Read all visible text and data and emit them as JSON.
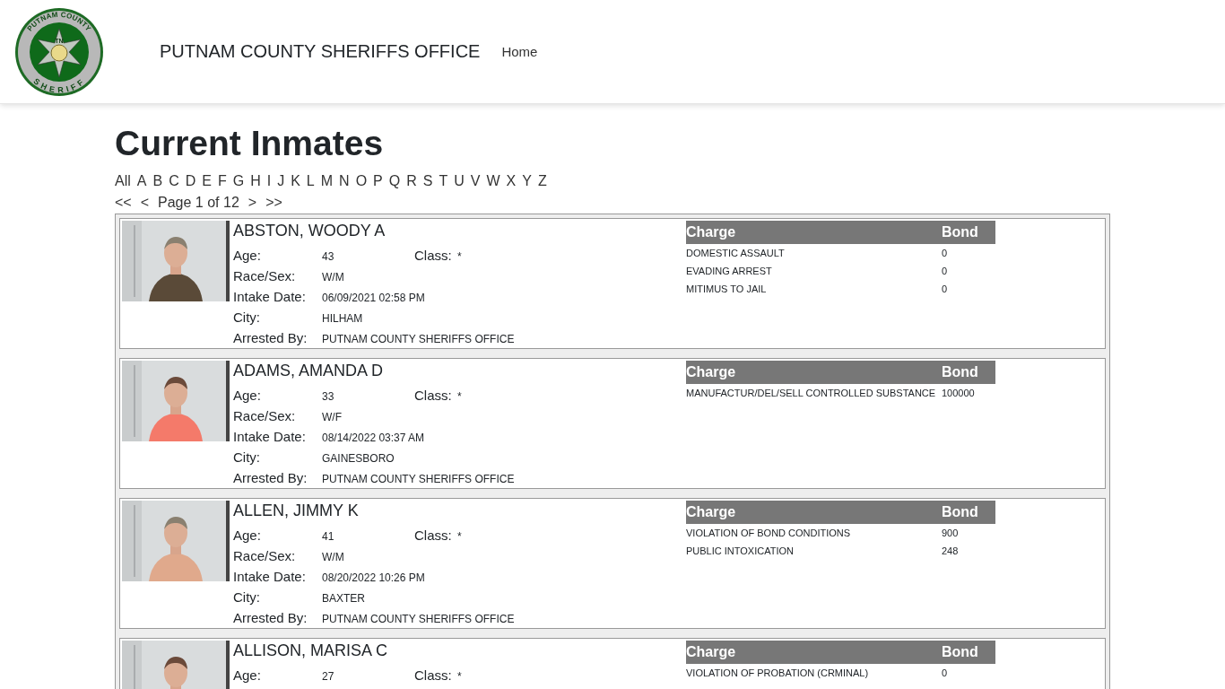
{
  "header": {
    "logo_top": "PUTNAM COUNTY",
    "logo_bottom": "SHERIFF",
    "logo_state": "TN",
    "brand": "PUTNAM COUNTY SHERIFFS OFFICE",
    "nav": [
      "Home"
    ]
  },
  "title": "Current Inmates",
  "letters": [
    "All",
    "A",
    "B",
    "C",
    "D",
    "E",
    "F",
    "G",
    "H",
    "I",
    "J",
    "K",
    "L",
    "M",
    "N",
    "O",
    "P",
    "Q",
    "R",
    "S",
    "T",
    "U",
    "V",
    "W",
    "X",
    "Y",
    "Z"
  ],
  "pager": {
    "first": "<<",
    "prev": "<",
    "label": "Page 1 of 12",
    "next": ">",
    "last": ">>"
  },
  "inmates": [
    {
      "name": "ABSTON, WOODY A",
      "fields": [
        {
          "label": "Age:",
          "value": "43"
        },
        {
          "label": "Race/Sex:",
          "value": "W/M"
        },
        {
          "label": "Intake Date:",
          "value": "06/09/2021 02:58 PM"
        },
        {
          "label": "City:",
          "value": "HILHAM"
        },
        {
          "label": "Arrested By:",
          "value": "PUTNAM COUNTY SHERIFFS OFFICE"
        }
      ],
      "class": {
        "label": "Class:",
        "value": "*"
      },
      "charge_header": "Charge",
      "bond_header": "Bond",
      "charges": [
        {
          "charge": "DOMESTIC ASSAULT",
          "bond": "0"
        },
        {
          "charge": "EVADING ARREST",
          "bond": "0"
        },
        {
          "charge": "MITIMUS TO JAIL",
          "bond": "0"
        }
      ]
    },
    {
      "name": "ADAMS, AMANDA D",
      "fields": [
        {
          "label": "Age:",
          "value": "33"
        },
        {
          "label": "Race/Sex:",
          "value": "W/F"
        },
        {
          "label": "Intake Date:",
          "value": "08/14/2022 03:37 AM"
        },
        {
          "label": "City:",
          "value": "GAINESBORO"
        },
        {
          "label": "Arrested By:",
          "value": "PUTNAM COUNTY SHERIFFS OFFICE"
        }
      ],
      "class": {
        "label": "Class:",
        "value": "*"
      },
      "charge_header": "Charge",
      "bond_header": "Bond",
      "charges": [
        {
          "charge": "MANUFACTUR/DEL/SELL CONTROLLED SUBSTANCE",
          "bond": "100000"
        }
      ]
    },
    {
      "name": "ALLEN, JIMMY K",
      "fields": [
        {
          "label": "Age:",
          "value": "41"
        },
        {
          "label": "Race/Sex:",
          "value": "W/M"
        },
        {
          "label": "Intake Date:",
          "value": "08/20/2022 10:26 PM"
        },
        {
          "label": "City:",
          "value": "BAXTER"
        },
        {
          "label": "Arrested By:",
          "value": "PUTNAM COUNTY SHERIFFS OFFICE"
        }
      ],
      "class": {
        "label": "Class:",
        "value": "*"
      },
      "charge_header": "Charge",
      "bond_header": "Bond",
      "charges": [
        {
          "charge": "VIOLATION OF BOND CONDITIONS",
          "bond": "900"
        },
        {
          "charge": "PUBLIC INTOXICATION",
          "bond": "248"
        }
      ]
    },
    {
      "name": "ALLISON, MARISA C",
      "fields": [
        {
          "label": "Age:",
          "value": "27"
        }
      ],
      "class": {
        "label": "Class:",
        "value": "*"
      },
      "charge_header": "Charge",
      "bond_header": "Bond",
      "charges": [
        {
          "charge": "VIOLATION OF PROBATION (CRMINAL)",
          "bond": "0"
        }
      ]
    }
  ]
}
